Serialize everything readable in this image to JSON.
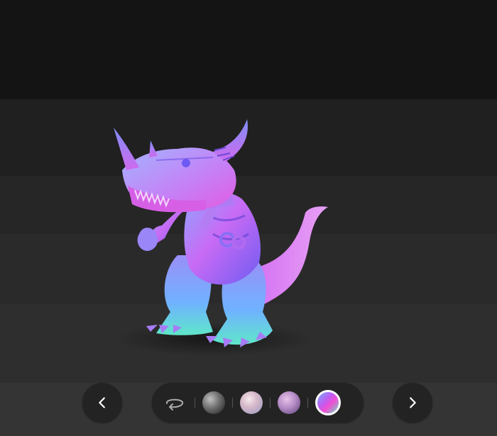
{
  "viewer": {
    "subject": "3d-model",
    "shading": "normal-map"
  },
  "controls": {
    "prev_icon": "chevron-left-icon",
    "next_icon": "chevron-right-icon",
    "rotate_icon": "rotate-icon"
  },
  "materials": [
    {
      "name": "material-sphere-1",
      "style": "dark-textured"
    },
    {
      "name": "material-sphere-2",
      "style": "pastel-smooth"
    },
    {
      "name": "material-sphere-3",
      "style": "purple-textured"
    },
    {
      "name": "material-sphere-4",
      "style": "normal-map",
      "selected": true
    }
  ],
  "colors": {
    "button_bg": "#232323",
    "icon": "#ffffff",
    "selected_ring": "#ffffff"
  }
}
